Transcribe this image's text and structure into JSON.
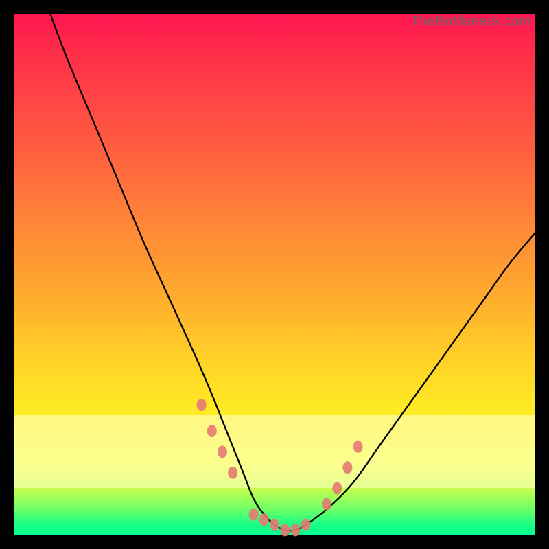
{
  "watermark": "TheBottleneck.com",
  "chart_data": {
    "type": "line",
    "title": "",
    "xlabel": "",
    "ylabel": "",
    "xlim": [
      0,
      100
    ],
    "ylim": [
      0,
      100
    ],
    "series": [
      {
        "name": "bottleneck-curve",
        "x": [
          7,
          10,
          15,
          20,
          25,
          30,
          35,
          38,
          40,
          42,
          44,
          46,
          48,
          50,
          52,
          54,
          56,
          60,
          65,
          70,
          75,
          80,
          85,
          90,
          95,
          100
        ],
        "values": [
          100,
          92,
          80,
          68,
          56,
          45,
          34,
          27,
          22,
          17,
          12,
          7,
          4,
          2,
          1,
          1,
          2,
          5,
          10,
          17,
          24,
          31,
          38,
          45,
          52,
          58
        ]
      }
    ],
    "markers": {
      "name": "highlight-points",
      "x": [
        36,
        38,
        40,
        42,
        46,
        48,
        50,
        52,
        54,
        56,
        60,
        62,
        64,
        66
      ],
      "values": [
        25,
        20,
        16,
        12,
        4,
        3,
        2,
        1,
        1,
        2,
        6,
        9,
        13,
        17
      ]
    },
    "band": {
      "y0": 9,
      "y1": 23
    }
  }
}
